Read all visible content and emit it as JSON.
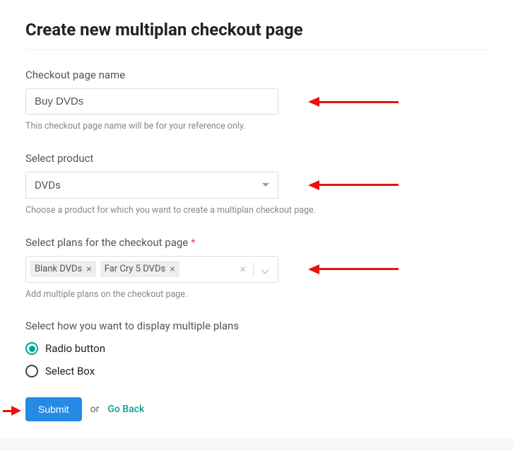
{
  "title": "Create new multiplan checkout page",
  "fields": {
    "name": {
      "label": "Checkout page name",
      "value": "Buy DVDs",
      "helper": "This checkout page name will be for your reference only."
    },
    "product": {
      "label": "Select product",
      "value": "DVDs",
      "helper": "Choose a product for which you want to create a multiplan checkout page."
    },
    "plans": {
      "label": "Select plans for the checkout page",
      "required_mark": "*",
      "chips": [
        "Blank DVDs",
        "Far Cry 5 DVDs"
      ],
      "helper": "Add multiple plans on the checkout page."
    },
    "display": {
      "label": "Select how you want to display multiple plans",
      "options": [
        {
          "label": "Radio button",
          "checked": true
        },
        {
          "label": "Select Box",
          "checked": false
        }
      ]
    }
  },
  "actions": {
    "submit": "Submit",
    "or": "or",
    "back": "Go Back"
  }
}
